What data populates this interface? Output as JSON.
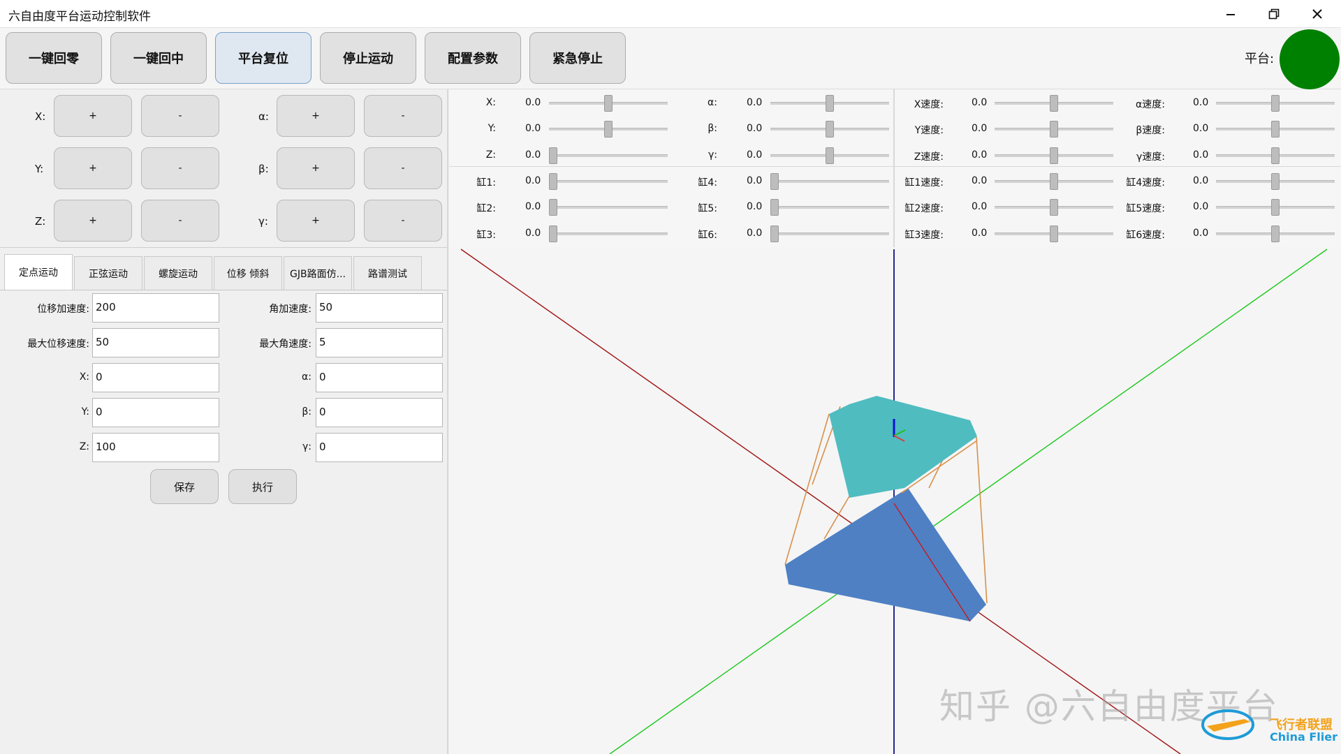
{
  "window": {
    "title": "六自由度平台运动控制软件",
    "min_icon": "minimize-icon",
    "restore_icon": "restore-icon",
    "close_icon": "close-icon"
  },
  "toolbar": {
    "buttons": [
      "一键回零",
      "一键回中",
      "平台复位",
      "停止运动",
      "配置参数",
      "紧急停止"
    ],
    "platform_label": "平台:",
    "platform_status_color": "#008000"
  },
  "jog": {
    "rows": [
      {
        "left_label": "X:",
        "right_label": "α:"
      },
      {
        "left_label": "Y:",
        "right_label": "β:"
      },
      {
        "left_label": "Z:",
        "right_label": "γ:"
      }
    ],
    "plus": "+",
    "minus": "-"
  },
  "tabs": [
    "定点运动",
    "正弦运动",
    "螺旋运动",
    "位移 倾斜",
    "GJB路面仿...",
    "路谱测试"
  ],
  "form": {
    "fields": [
      {
        "left_label": "位移加速度:",
        "left_value": "200",
        "right_label": "角加速度:",
        "right_value": "50"
      },
      {
        "left_label": "最大位移速度:",
        "left_value": "50",
        "right_label": "最大角速度:",
        "right_value": "5"
      },
      {
        "left_label": "X:",
        "left_value": "0",
        "right_label": "α:",
        "right_value": "0"
      },
      {
        "left_label": "Y:",
        "left_value": "0",
        "right_label": "β:",
        "right_value": "0"
      },
      {
        "left_label": "Z:",
        "left_value": "100",
        "right_label": "γ:",
        "right_value": "0"
      }
    ],
    "save_label": "保存",
    "exec_label": "执行"
  },
  "sliders": {
    "columns": [
      [
        {
          "label": "X:",
          "value": "0.0",
          "level": 0.5
        },
        {
          "label": "Y:",
          "value": "0.0",
          "level": 0.5
        },
        {
          "label": "Z:",
          "value": "0.0",
          "level": 0.0
        },
        {
          "label": "缸1:",
          "value": "0.0",
          "level": 0.0
        },
        {
          "label": "缸2:",
          "value": "0.0",
          "level": 0.0
        },
        {
          "label": "缸3:",
          "value": "0.0",
          "level": 0.0
        }
      ],
      [
        {
          "label": "α:",
          "value": "0.0",
          "level": 0.5
        },
        {
          "label": "β:",
          "value": "0.0",
          "level": 0.5
        },
        {
          "label": "γ:",
          "value": "0.0",
          "level": 0.5
        },
        {
          "label": "缸4:",
          "value": "0.0",
          "level": 0.0
        },
        {
          "label": "缸5:",
          "value": "0.0",
          "level": 0.0
        },
        {
          "label": "缸6:",
          "value": "0.0",
          "level": 0.0
        }
      ],
      [
        {
          "label": "X速度:",
          "value": "0.0",
          "level": 0.5
        },
        {
          "label": "Y速度:",
          "value": "0.0",
          "level": 0.5
        },
        {
          "label": "Z速度:",
          "value": "0.0",
          "level": 0.5
        },
        {
          "label": "缸1速度:",
          "value": "0.0",
          "level": 0.5
        },
        {
          "label": "缸2速度:",
          "value": "0.0",
          "level": 0.5
        },
        {
          "label": "缸3速度:",
          "value": "0.0",
          "level": 0.5
        }
      ],
      [
        {
          "label": "α速度:",
          "value": "0.0",
          "level": 0.5
        },
        {
          "label": "β速度:",
          "value": "0.0",
          "level": 0.5
        },
        {
          "label": "γ速度:",
          "value": "0.0",
          "level": 0.5
        },
        {
          "label": "缸4速度:",
          "value": "0.0",
          "level": 0.5
        },
        {
          "label": "缸5速度:",
          "value": "0.0",
          "level": 0.5
        },
        {
          "label": "缸6速度:",
          "value": "0.0",
          "level": 0.5
        }
      ]
    ]
  },
  "view3d": {
    "axis_colors": {
      "x": "#a01010",
      "y": "#18c818",
      "z": "#10108c"
    },
    "top_plate_color": "#4fbcc0",
    "base_plate_color": "#4f80c4",
    "actuator_color": "#d8904a"
  },
  "watermark": {
    "text": "知乎 @六自由度平台",
    "logo_text_cn": "飞行者联盟",
    "logo_text_en": "China Flier"
  }
}
